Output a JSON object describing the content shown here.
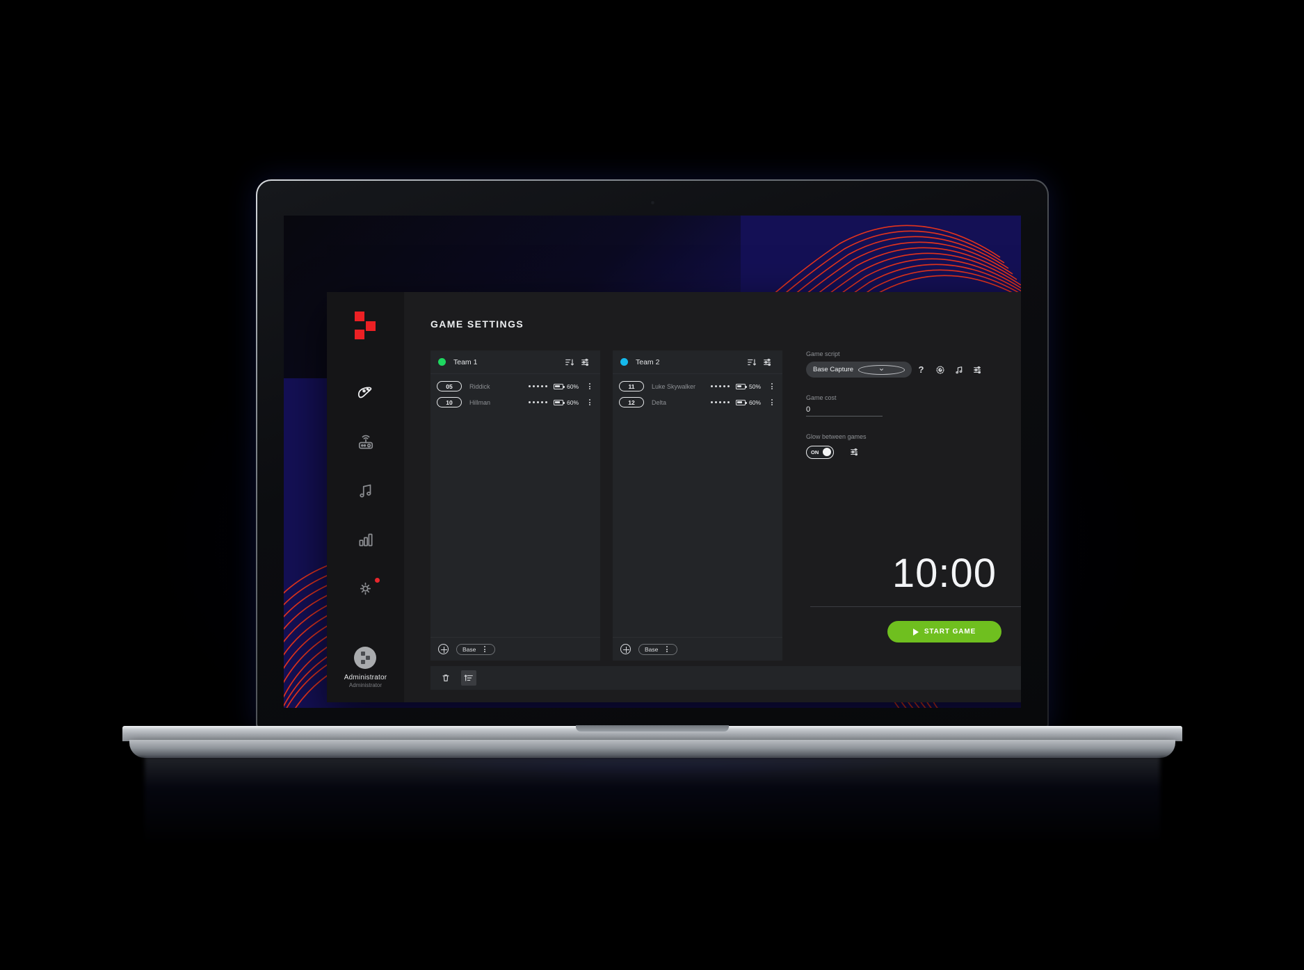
{
  "app": {
    "window_title": "GAME SETTINGS",
    "logo_color": "#ec2024",
    "window_controls": [
      {
        "name": "minimize",
        "label": "–"
      },
      {
        "name": "restore",
        "label": "❐"
      },
      {
        "name": "close",
        "label": "✕"
      }
    ]
  },
  "sidebar": {
    "items": [
      {
        "icon": "gamepad-icon",
        "label": "Games",
        "active": true,
        "badge": false
      },
      {
        "icon": "device-router-icon",
        "label": "Devices",
        "active": false,
        "badge": false
      },
      {
        "icon": "music-note-icon",
        "label": "Music",
        "active": false,
        "badge": false
      },
      {
        "icon": "bar-chart-icon",
        "label": "Statistics",
        "active": false,
        "badge": false
      },
      {
        "icon": "gear-icon",
        "label": "Settings",
        "active": false,
        "badge": true
      }
    ],
    "user": {
      "name": "Administrator",
      "role": "Administrator",
      "avatar": "logo-avatar"
    }
  },
  "teams": [
    {
      "name": "Team 1",
      "color": "#1ed760",
      "header_icons": [
        "sort-icon",
        "sliders-icon"
      ],
      "players": [
        {
          "number": "05",
          "name": "Riddick",
          "signal": 5,
          "battery": "60%",
          "battery_level": 60
        },
        {
          "number": "10",
          "name": "Hillman",
          "signal": 5,
          "battery": "60%",
          "battery_level": 60
        }
      ],
      "footer": {
        "add_icon": "plus-circle-icon",
        "chip_label": "Base",
        "chip_menu": "kebab-icon"
      }
    },
    {
      "name": "Team 2",
      "color": "#15b9ec",
      "header_icons": [
        "sort-icon",
        "sliders-icon"
      ],
      "players": [
        {
          "number": "11",
          "name": "Luke Skywalker",
          "signal": 5,
          "battery": "50%",
          "battery_level": 50
        },
        {
          "number": "12",
          "name": "Delta",
          "signal": 5,
          "battery": "60%",
          "battery_level": 60
        }
      ],
      "footer": {
        "add_icon": "plus-circle-icon",
        "chip_label": "Base",
        "chip_menu": "kebab-icon"
      }
    }
  ],
  "settings": {
    "game_script": {
      "label": "Game script",
      "value": "Base Capture"
    },
    "script_icons": [
      "help-icon",
      "dial-icon",
      "music-note-icon",
      "sliders-icon"
    ],
    "game_cost": {
      "label": "Game cost",
      "value": "0"
    },
    "glow": {
      "label": "Glow between games",
      "toggle_text": "ON",
      "toggle_on": true,
      "settings_icon": "sliders-icon"
    },
    "timer": "10:00",
    "start_button": "START GAME",
    "start_button_color": "#6fbf1f"
  },
  "bottom_bar": {
    "icons": [
      {
        "name": "trash-icon",
        "boxed": false
      },
      {
        "name": "sort-icon",
        "boxed": true
      }
    ]
  }
}
